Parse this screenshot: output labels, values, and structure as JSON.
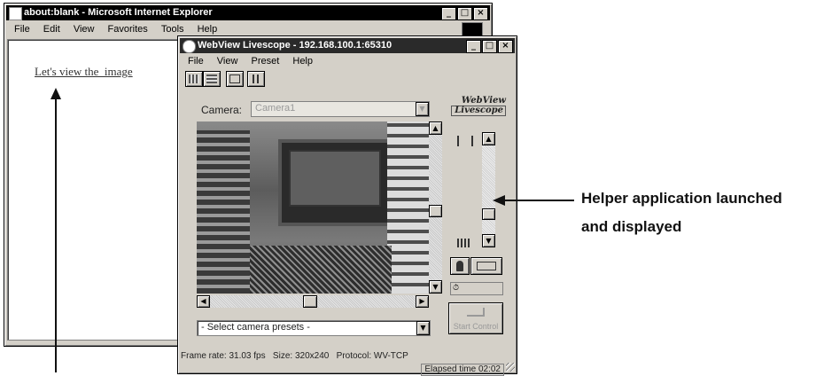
{
  "ie": {
    "title": "about:blank - Microsoft Internet Explorer",
    "menu": [
      "File",
      "Edit",
      "View",
      "Favorites",
      "Tools",
      "Help"
    ],
    "link_text": "Let's view the  image"
  },
  "helper": {
    "title": "WebView Livescope - 192.168.100.1:65310",
    "menu": [
      "File",
      "View",
      "Preset",
      "Help"
    ],
    "logo_line1": "WebView",
    "logo_line2": "Livescope",
    "camera_label": "Camera:",
    "camera_value": "Camera1",
    "preset_placeholder": "- Select camera presets -",
    "start_control_label": "Start Control",
    "status_line": "Frame rate: 31.03 fps   Size: 320x240   Protocol: WV-TCP",
    "elapsed": "Elapsed time 02:02"
  },
  "annotation": {
    "line1": "Helper application launched",
    "line2": "and displayed"
  },
  "icons": {
    "minimize": "_",
    "maximize": "□",
    "close": "×",
    "scroll_up": "▲",
    "scroll_down": "▼",
    "scroll_left": "◀",
    "scroll_right": "▶",
    "dropdown": "▼",
    "timer": "⏱"
  },
  "colors": {
    "window_face": "#d4d0c8",
    "title_bar": "#000000",
    "video_bg": "#6b6b6b"
  }
}
